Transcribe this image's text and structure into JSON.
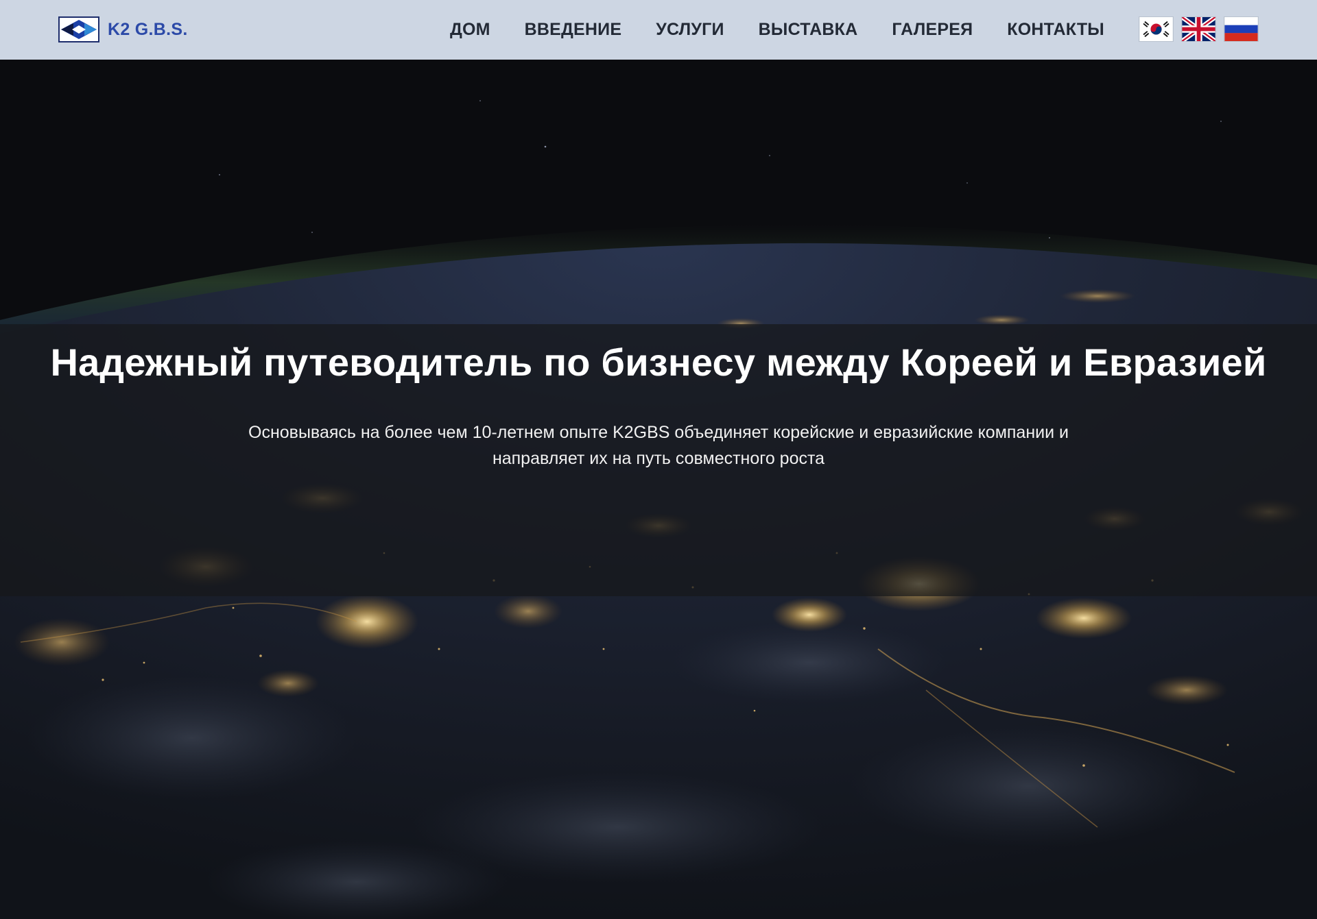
{
  "brand": {
    "name": "K2 G.B.S."
  },
  "nav": {
    "items": [
      "ДОМ",
      "ВВЕДЕНИЕ",
      "УСЛУГИ",
      "ВЫСТАВКА",
      "ГАЛЕРЕЯ",
      "КОНТАКТЫ"
    ]
  },
  "languages": [
    {
      "icon": "korea-flag-icon"
    },
    {
      "icon": "uk-flag-icon"
    },
    {
      "icon": "russia-flag-icon"
    }
  ],
  "hero": {
    "title": "Надежный путеводитель по бизнесу между Кореей и Евразией",
    "subtitle_line1": "Основываясь на более чем 10-летнем опыте K2GBS объединяет корейские и евразийские компании и",
    "subtitle_line2": "направляет их на путь совместного роста"
  },
  "colors": {
    "header_bg": "#cdd6e3",
    "brand_text": "#2c4aa8",
    "nav_text": "#232a36",
    "hero_text": "#ffffff"
  }
}
